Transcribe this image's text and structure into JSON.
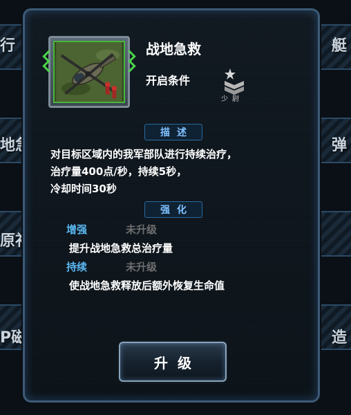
{
  "background": {
    "left_labels": [
      "行",
      "地急",
      "原补",
      "P磁"
    ],
    "right_labels": [
      "艇",
      "弹",
      "",
      "造"
    ]
  },
  "skill": {
    "name": "战地急救",
    "unlock_label": "开启条件",
    "rank": "少尉",
    "thumbnail_icon": "helicopter-medic-icon"
  },
  "description": {
    "title": "描述",
    "lines": [
      "对目标区域内的我军部队进行持续治疗，",
      "治疗量400点/秒，持续5秒，",
      "冷却时间30秒"
    ]
  },
  "enhance": {
    "title": "强化",
    "items": [
      {
        "label": "增强",
        "status": "未升级",
        "desc": "提升战地急救总治疗量"
      },
      {
        "label": "持续",
        "status": "未升级",
        "desc": "使战地急救释放后额外恢复生命值"
      }
    ]
  },
  "upgrade_button": "升级",
  "colors": {
    "accent_blue": "#59b7f0",
    "locked_gray": "#6e6e6e",
    "frame_green": "#48b63a"
  }
}
